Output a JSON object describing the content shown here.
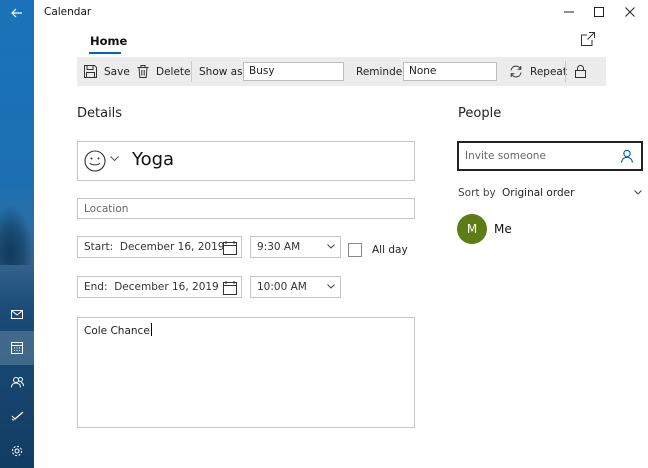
{
  "app": {
    "title": "Calendar"
  },
  "tabs": {
    "home": "Home"
  },
  "toolbar": {
    "save_label": "Save",
    "delete_label": "Delete",
    "show_as_label": "Show as:",
    "show_as_value": "Busy",
    "reminder_label": "Reminder:",
    "reminder_value": "None",
    "repeat_label": "Repeat"
  },
  "details": {
    "heading": "Details",
    "event_title": "Yoga",
    "location_placeholder": "Location",
    "start_label": "Start:",
    "start_date": "December 16, 2019",
    "start_time": "9:30 AM",
    "end_label": "End:",
    "end_date": "December 16, 2019",
    "end_time": "10:00 AM",
    "all_day_label": "All day",
    "notes": "Cole Chance"
  },
  "people": {
    "heading": "People",
    "invite_placeholder": "Invite someone",
    "sort_label": "Sort by",
    "sort_value": "Original order",
    "attendees": [
      {
        "initial": "M",
        "name": "Me"
      }
    ]
  },
  "colors": {
    "accent": "#0067c0",
    "avatar": "#5c7d16"
  }
}
